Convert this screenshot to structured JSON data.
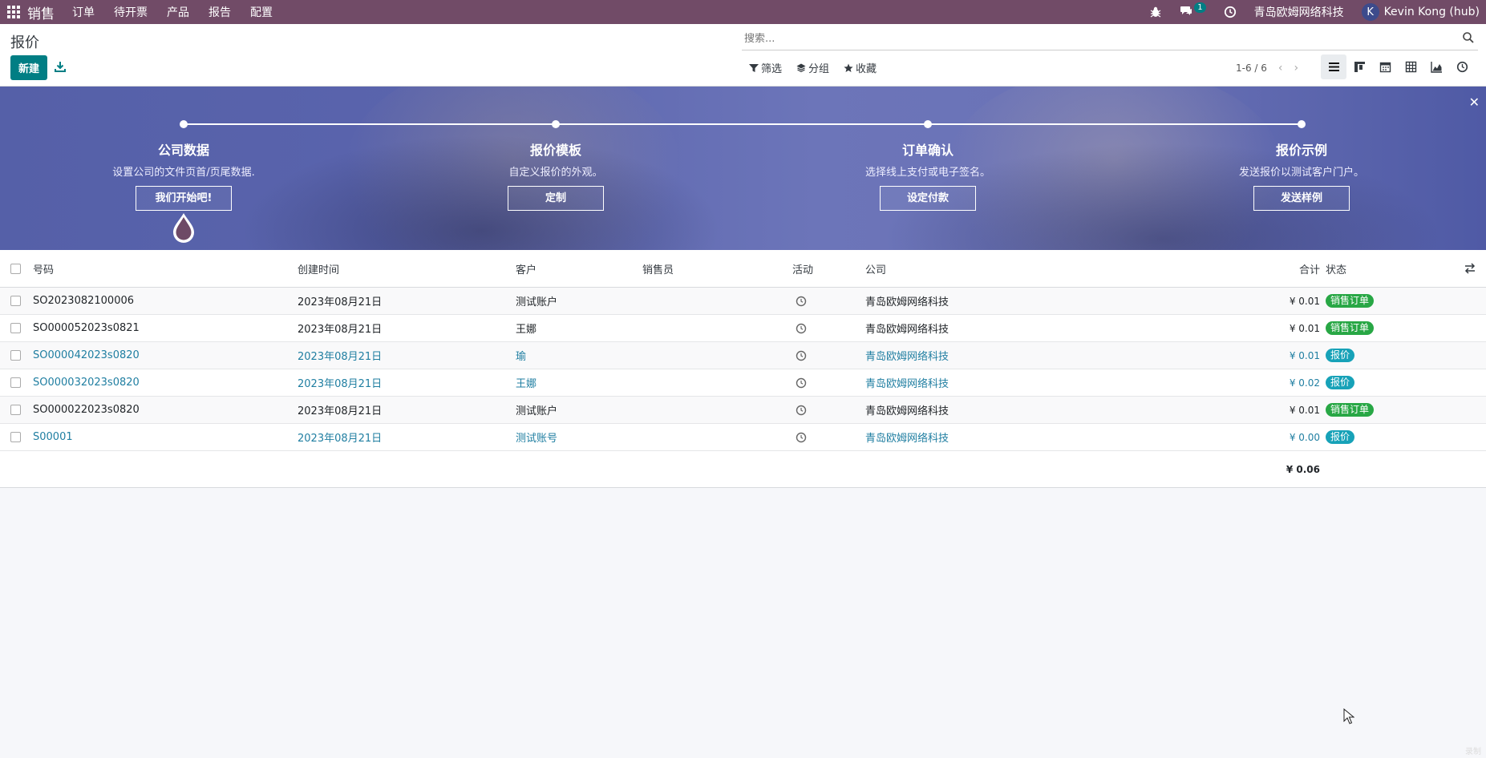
{
  "navbar": {
    "brand": "销售",
    "menu": [
      "订单",
      "待开票",
      "产品",
      "报告",
      "配置"
    ],
    "message_count": "1",
    "company": "青岛欧姆网络科技",
    "user_initial": "K",
    "user_name": "Kevin Kong (hub)"
  },
  "control": {
    "title": "报价",
    "new_button": "新建",
    "search_placeholder": "搜索...",
    "filter_label": "筛选",
    "group_label": "分组",
    "favorite_label": "收藏",
    "pager": "1-6 / 6"
  },
  "banner": {
    "steps": [
      {
        "title": "公司数据",
        "desc": "设置公司的文件页首/页尾数据.",
        "button": "我们开始吧!"
      },
      {
        "title": "报价模板",
        "desc": "自定义报价的外观。",
        "button": "定制"
      },
      {
        "title": "订单确认",
        "desc": "选择线上支付或电子签名。",
        "button": "设定付款"
      },
      {
        "title": "报价示例",
        "desc": "发送报价以测试客户门户。",
        "button": "发送样例"
      }
    ]
  },
  "list": {
    "columns": {
      "number": "号码",
      "created": "创建时间",
      "customer": "客户",
      "salesperson": "销售员",
      "activity": "活动",
      "company": "公司",
      "total": "合计",
      "state": "状态"
    },
    "rows": [
      {
        "number": "SO2023082100006",
        "created": "2023年08月21日",
        "customer": "测试账户",
        "company": "青岛欧姆网络科技",
        "total": "¥ 0.01",
        "state": "销售订单",
        "state_color": "#28a745",
        "highlight": false
      },
      {
        "number": "SO000052023s0821",
        "created": "2023年08月21日",
        "customer": "王娜",
        "company": "青岛欧姆网络科技",
        "total": "¥ 0.01",
        "state": "销售订单",
        "state_color": "#28a745",
        "highlight": false
      },
      {
        "number": "SO000042023s0820",
        "created": "2023年08月21日",
        "customer": "瑜",
        "company": "青岛欧姆网络科技",
        "total": "¥ 0.01",
        "state": "报价",
        "state_color": "#17a2b8",
        "highlight": true
      },
      {
        "number": "SO000032023s0820",
        "created": "2023年08月21日",
        "customer": "王娜",
        "company": "青岛欧姆网络科技",
        "total": "¥ 0.02",
        "state": "报价",
        "state_color": "#17a2b8",
        "highlight": true
      },
      {
        "number": "SO000022023s0820",
        "created": "2023年08月21日",
        "customer": "测试账户",
        "company": "青岛欧姆网络科技",
        "total": "¥ 0.01",
        "state": "销售订单",
        "state_color": "#28a745",
        "highlight": false
      },
      {
        "number": "S00001",
        "created": "2023年08月21日",
        "customer": "测试账号",
        "company": "青岛欧姆网络科技",
        "total": "¥ 0.00",
        "state": "报价",
        "state_color": "#17a2b8",
        "highlight": true
      }
    ],
    "grand_total": "¥ 0.06"
  },
  "corner_tag": "录制",
  "colors": {
    "navbar": "#714b67",
    "primary": "#017e84",
    "link": "#1f7ea1"
  }
}
